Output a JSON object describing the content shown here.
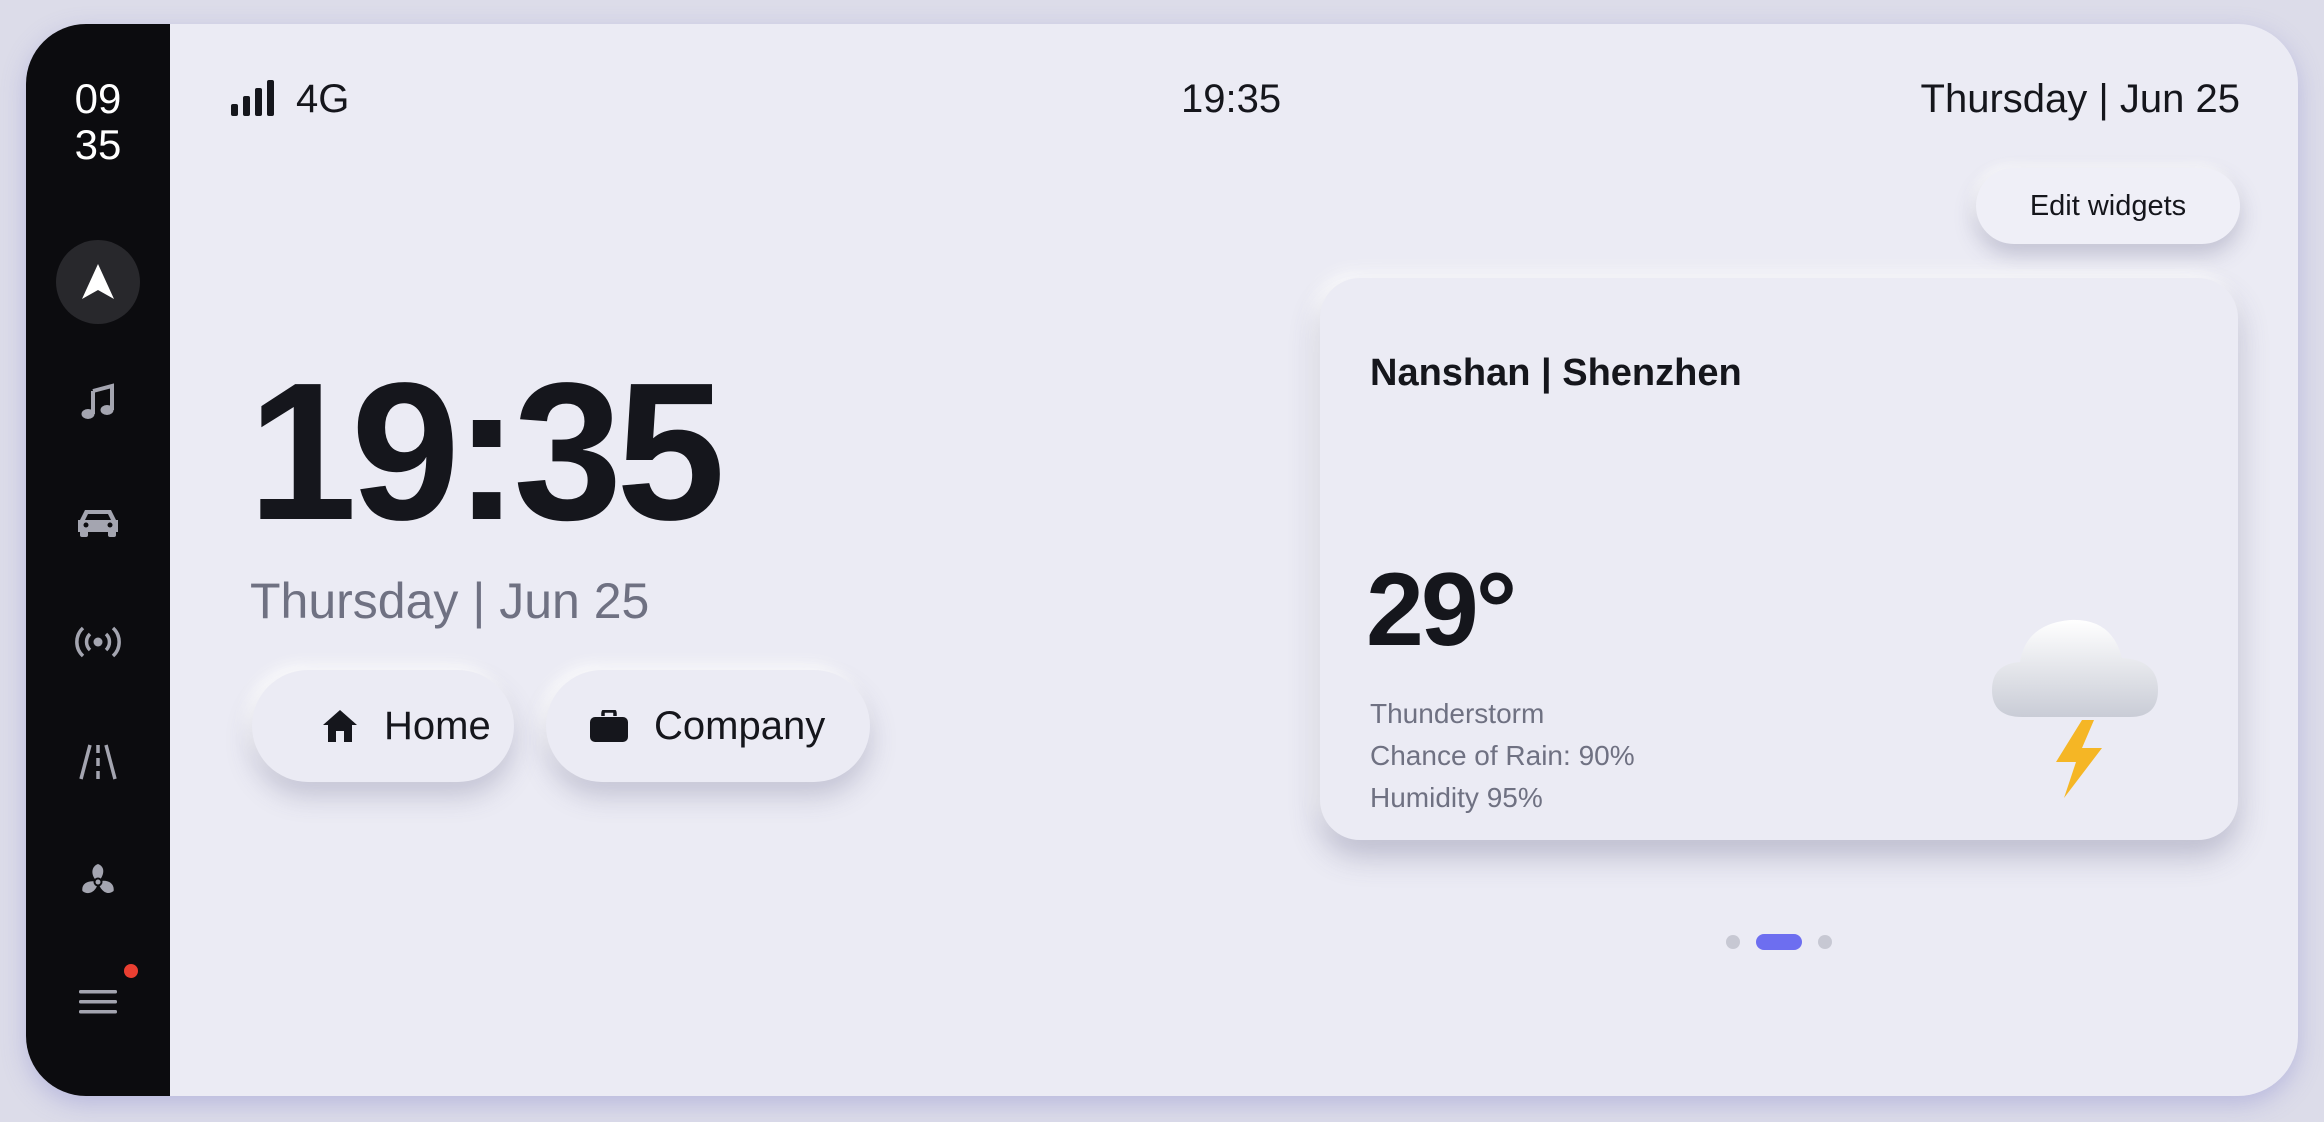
{
  "sidebar": {
    "clock_hours": "09",
    "clock_minutes": "35",
    "items": [
      {
        "name": "navigation",
        "icon": "navigation-arrow-icon",
        "active": true
      },
      {
        "name": "music",
        "icon": "music-note-icon",
        "active": false
      },
      {
        "name": "car",
        "icon": "car-icon",
        "active": false
      },
      {
        "name": "radio",
        "icon": "radio-broadcast-icon",
        "active": false
      },
      {
        "name": "road",
        "icon": "road-lanes-icon",
        "active": false
      },
      {
        "name": "fan",
        "icon": "fan-icon",
        "active": false
      },
      {
        "name": "menu",
        "icon": "menu-icon",
        "active": false,
        "has_badge": true
      }
    ]
  },
  "status_bar": {
    "network": "4G",
    "time": "19:35",
    "date": "Thursday | Jun 25"
  },
  "toolbar": {
    "edit_widgets_label": "Edit widgets"
  },
  "home": {
    "clock": "19:35",
    "date": "Thursday | Jun 25",
    "destinations": [
      {
        "label": "Home",
        "icon": "home-icon"
      },
      {
        "label": "Company",
        "icon": "briefcase-icon"
      }
    ]
  },
  "weather": {
    "location": "Nanshan | Shenzhen",
    "temperature": "29°",
    "condition": "Thunderstorm",
    "rain_chance": "Chance of Rain: 90%",
    "humidity": "Humidity 95%",
    "icon": "thunderstorm-icon"
  },
  "pager": {
    "pages": 3,
    "active_index": 1
  },
  "colors": {
    "sidebar_bg": "#0c0c0f",
    "accent": "#6d6ef0",
    "badge": "#ea3f31",
    "lightning": "#f5b625"
  }
}
